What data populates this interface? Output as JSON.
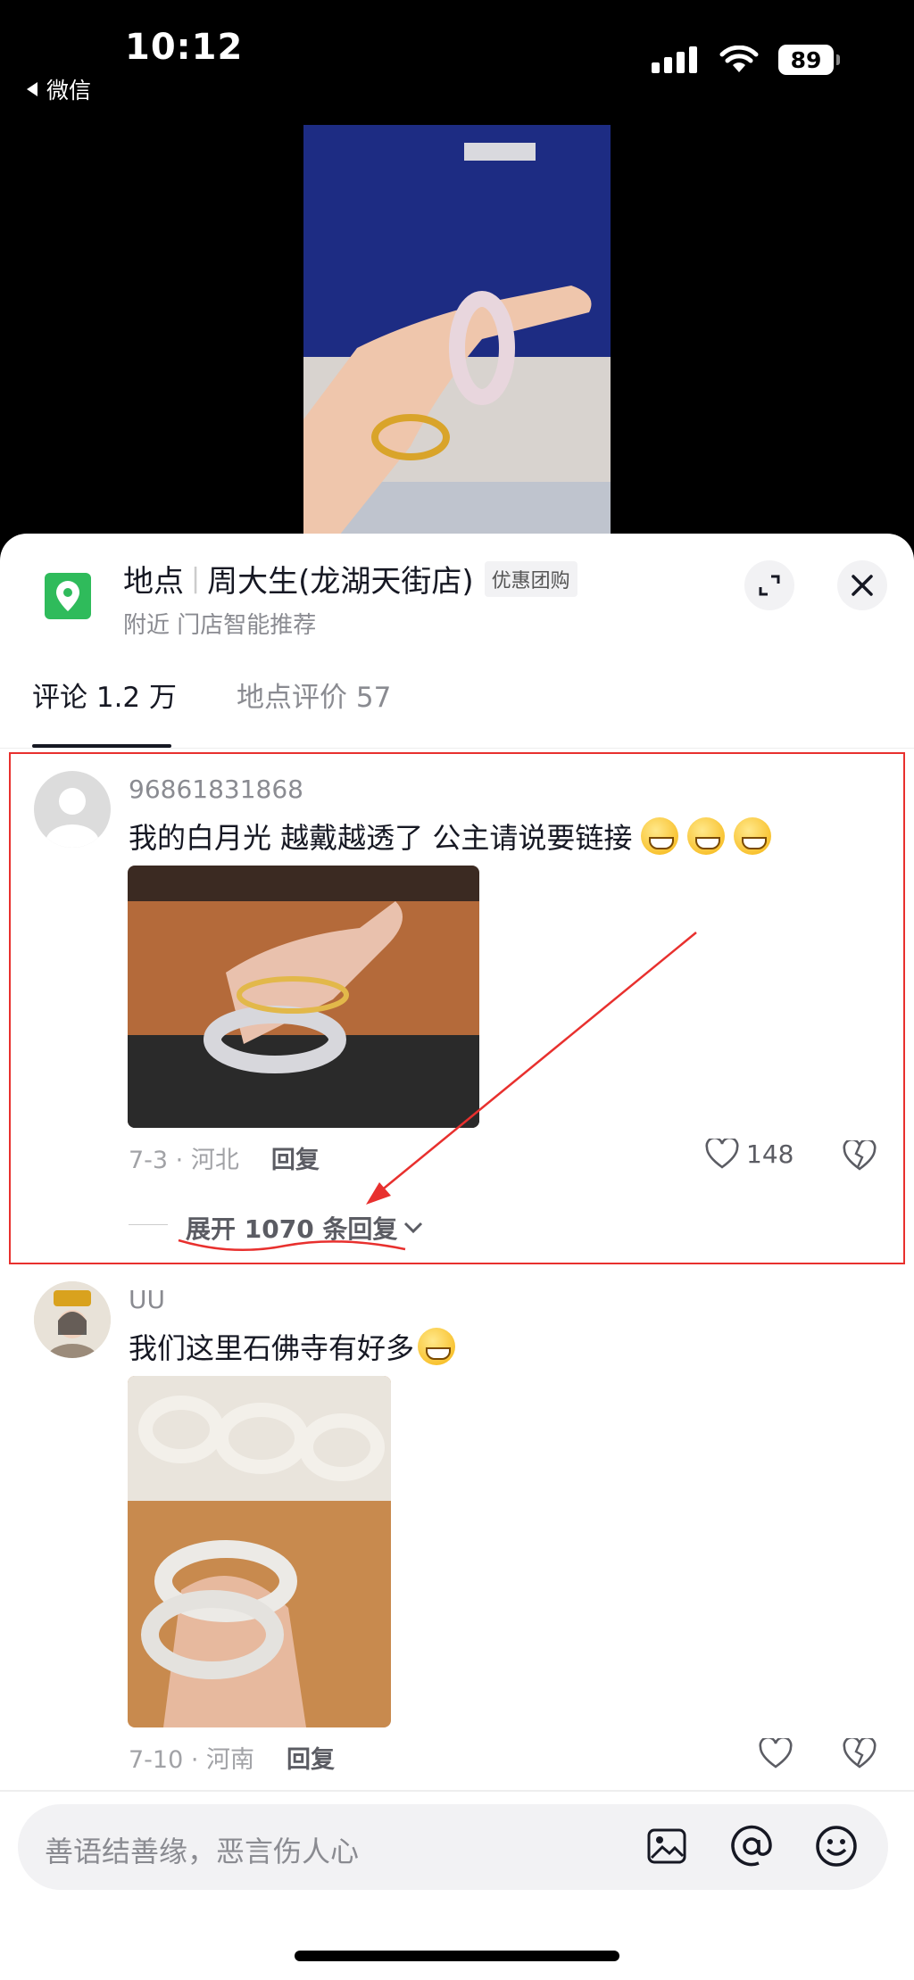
{
  "status_bar": {
    "time": "10:12",
    "back_app": "微信",
    "battery": "89"
  },
  "location": {
    "label": "地点",
    "store_name": "周大生(龙湖天街店)",
    "promo_badge": "优惠团购",
    "subtitle": "附近 门店智能推荐"
  },
  "tabs": [
    {
      "label": "评论 1.2 万",
      "active": true
    },
    {
      "label": "地点评价 57",
      "active": false
    }
  ],
  "comments": [
    {
      "username": "96861831868",
      "text": "我的白月光 越戴越透了 公主请说要链接",
      "date_region": "7-3 · 河北",
      "reply_label": "回复",
      "likes": "148",
      "expand_label": "展开 1070 条回复"
    },
    {
      "username": "UU",
      "text": "我们这里石佛寺有好多",
      "date_region": "7-10 · 河南",
      "reply_label": "回复",
      "likes": ""
    }
  ],
  "input": {
    "placeholder": "善语结善缘，恶言伤人心"
  },
  "icons": [
    "location-pin-icon",
    "expand-icon",
    "close-icon",
    "heart-icon",
    "dislike-icon",
    "image-icon",
    "at-icon",
    "emoji-icon"
  ],
  "colors": {
    "highlight": "#e8302e",
    "pin": "#2fbb5b"
  }
}
